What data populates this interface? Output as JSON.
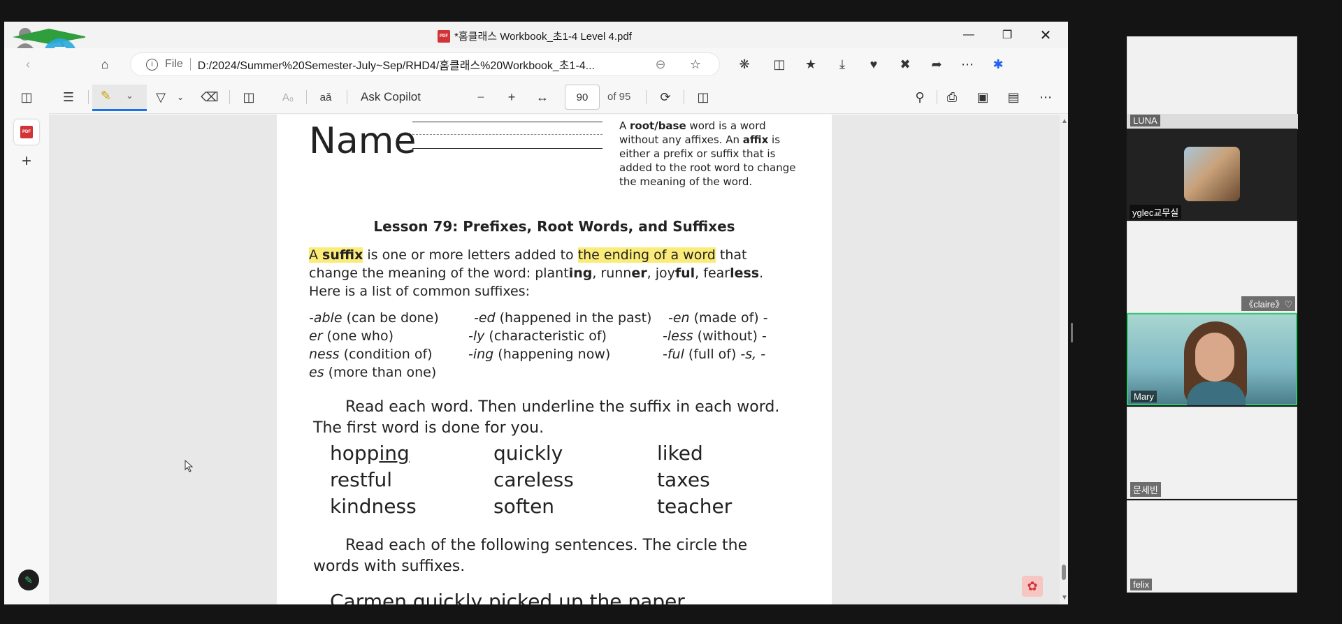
{
  "browser": {
    "tab_title": "*홈클래스 Workbook_초1-4 Level 4.pdf",
    "file_label": "File",
    "url": "D:/2024/Summer%20Semester-July~Sep/RHD4/홈클래스%20Workbook_초1-4...",
    "pdf_badge": "PDF"
  },
  "toolbar": {
    "ask_copilot": "Ask Copilot",
    "page_number": "90",
    "page_total": "of 95"
  },
  "document": {
    "name_label": "Name",
    "definition": [
      "A ",
      "root/base",
      " word is a word without any affixes. An ",
      "affix",
      " is either a prefix or suffix that is added to the root word to change the meaning of the word."
    ],
    "lesson_title": "Lesson 79: Prefixes, Root Words, and Suffixes",
    "intro_a": "A ",
    "intro_suffix": "suffix",
    "intro_mid": " is one or more letters added to ",
    "intro_hl": "the ending of a word",
    "intro_end": " that change the meaning of the word: plant",
    "ex1b": "ing",
    "ex1c": ", runn",
    "ex2b": "er",
    "ex2c": ", joy",
    "ex3b": "ful",
    "ex3c": ", fear",
    "ex4b": "less",
    "ex4c": ". Here is a list of common suffixes:",
    "suffix_rows": [
      [
        "-able",
        " (can be done)",
        "-ed",
        " (happened in the past)",
        "-en",
        " (made of) -"
      ],
      [
        "er",
        " (one who)",
        "-ly",
        " (characteristic of)",
        "-less",
        " (without) -"
      ],
      [
        "ness",
        " (condition of)",
        "-ing",
        " (happening now)",
        "-ful",
        " (full of) ",
        "-s, -"
      ],
      [
        "es",
        " (more than one)"
      ]
    ],
    "instruction1": "Read each word. Then underline the suffix in each word. The first word is done for you.",
    "words": [
      [
        "hopp",
        "ing",
        "quickly",
        "liked"
      ],
      [
        "restful",
        "careless",
        "taxes"
      ],
      [
        "kindness",
        "soften",
        "teacher"
      ]
    ],
    "instruction2": "Read each of the following sentences. The circle the words with suffixes.",
    "cutoff_sentence": "Carmen quickly picked up the paper"
  },
  "participants": [
    {
      "name": "LUNA"
    },
    {
      "name": "yglec교무실"
    },
    {
      "name": "《claire》♡"
    },
    {
      "name": "Mary"
    },
    {
      "name": "문세빈"
    },
    {
      "name": "felix"
    }
  ],
  "colors": {
    "highlight": "#fbec7a",
    "active_speaker": "#2ecc71"
  }
}
